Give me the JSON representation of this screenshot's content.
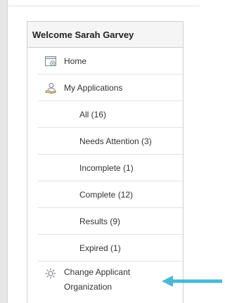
{
  "panel": {
    "welcome": "Welcome Sarah Garvey"
  },
  "nav": {
    "home": {
      "label": "Home",
      "icon": "calendar-home-icon"
    },
    "my_applications": {
      "label": "My Applications",
      "icon": "applications-icon"
    },
    "sub_items": [
      {
        "label": "All (16)"
      },
      {
        "label": "Needs Attention (3)"
      },
      {
        "label": "Incomplete (1)"
      },
      {
        "label": "Complete (12)"
      },
      {
        "label": "Results (9)"
      },
      {
        "label": "Expired (1)"
      }
    ],
    "change_org": {
      "label_line1": "Change Applicant",
      "label_line2": "Organization",
      "icon": "gear-icon"
    }
  },
  "annotation": {
    "arrow_color": "#4bb8d6",
    "arrow_direction": "left"
  }
}
